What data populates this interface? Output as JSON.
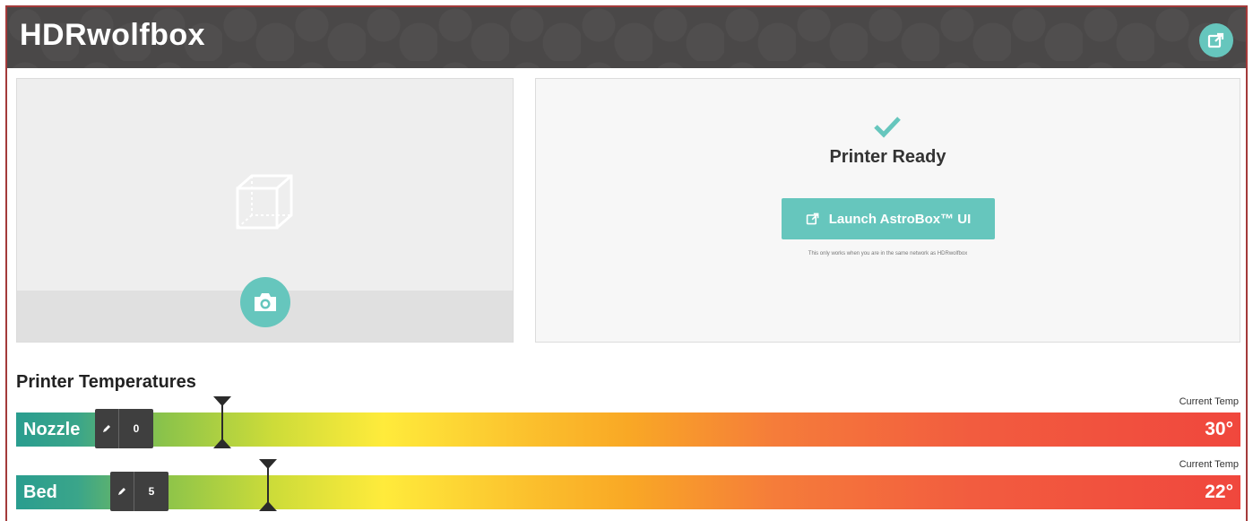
{
  "header": {
    "title": "HDRwolfbox",
    "external_icon": "external-link-icon"
  },
  "camera": {
    "placeholder_icon": "cube-icon",
    "snapshot_icon": "camera-icon"
  },
  "status": {
    "icon": "checkmark-icon",
    "title": "Printer Ready",
    "launch_label": "Launch AstroBox™ UI",
    "note": "This only works when you are in the same network as HDRwolfbox"
  },
  "temperatures": {
    "title": "Printer Temperatures",
    "rows": [
      {
        "label": "Nozzle",
        "target": "0",
        "current_label": "Current Temp",
        "current": "30°"
      },
      {
        "label": "Bed",
        "target": "5",
        "current_label": "Current Temp",
        "current": "22°"
      }
    ]
  },
  "colors": {
    "accent": "#66c6bd",
    "header_bg": "#4a4848",
    "frame_border": "#a33a3a"
  }
}
